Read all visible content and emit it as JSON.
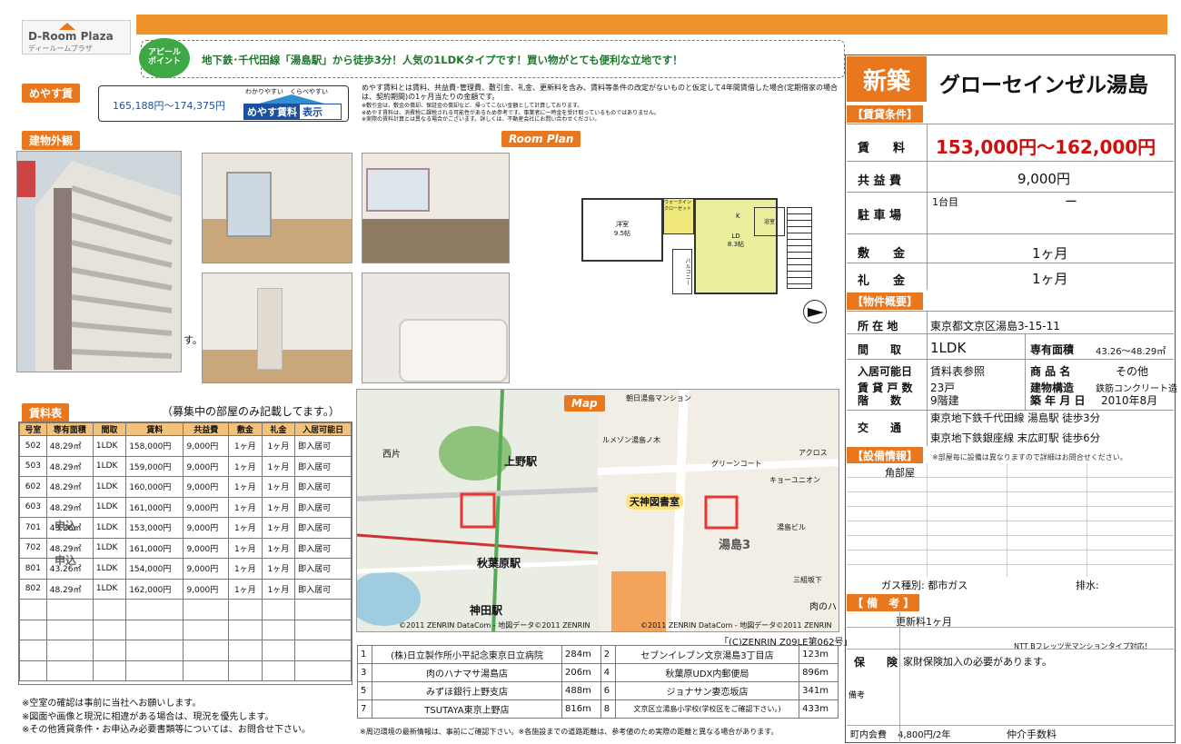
{
  "logo": {
    "line1": "D-Room Plaza",
    "line2": "ディールームプラザ"
  },
  "appeal": {
    "badge": "アピールポイント",
    "text": "地下鉄･千代田線「湯島駅」から徒歩3分！人気の1LDKタイプです！買い物がとても便利な立地です！"
  },
  "meyasu": {
    "tab": "めやす賃",
    "range": "165,188円～174,375円",
    "badge_top": "わかりやすい　くらべやすい",
    "badge": "めやす賃料",
    "badge_suffix": "表示",
    "note_main": "めやす賃料とは賃料、共益費･管理費、敷引金、礼金、更新料を含み、賃料等条件の改定がないものと仮定して4年間賃借した場合(定期借家の場合は、契約期間)の1ヶ月当たりの金額です。",
    "note_sub1": "※敷引金は、敷金の償却、保証金の償却など、帰ってこない金額として計算しております。",
    "note_sub2": "※めやす賃料は、消費税に課税される可能性があるため参考です。事業者に一時金を受け取っているものではありません。",
    "note_sub3": "※実際の賃料計算とは異なる場合がございます。詳しくは、不動産会社にお問い合わせください。"
  },
  "exterior_tab": "建物外観",
  "room_plan_tab": "Room Plan",
  "exterior_suffix": "す。",
  "floorplan": {
    "room1": "洋室",
    "room1_size": "9.5帖",
    "room2": "LD",
    "room2_size": "8.3帖",
    "closet": "ウォークインクローゼット",
    "bath": "浴室",
    "kitchen": "K",
    "balcony": "バルコニー"
  },
  "rent_table": {
    "tab": "賃料表",
    "note": "（募集中の部屋のみ記載してます。）",
    "headers": [
      "号室",
      "専有面積",
      "間取",
      "賃料",
      "共益費",
      "敷金",
      "礼金",
      "入居可能日"
    ],
    "rows": [
      [
        "502",
        "48.29㎡",
        "1LDK",
        "158,000円",
        "9,000円",
        "1ヶ月",
        "1ヶ月",
        "即入居可"
      ],
      [
        "503",
        "48.29㎡",
        "1LDK",
        "159,000円",
        "9,000円",
        "1ヶ月",
        "1ヶ月",
        "即入居可"
      ],
      [
        "602",
        "48.29㎡",
        "1LDK",
        "160,000円",
        "9,000円",
        "1ヶ月",
        "1ヶ月",
        "即入居可"
      ],
      [
        "603",
        "48.29㎡",
        "1LDK",
        "161,000円",
        "9,000円",
        "1ヶ月",
        "1ヶ月",
        "即入居可"
      ],
      [
        "701",
        "43.26㎡",
        "1LDK",
        "153,000円",
        "9,000円",
        "1ヶ月",
        "1ヶ月",
        "即入居可"
      ],
      [
        "702",
        "48.29㎡",
        "1LDK",
        "161,000円",
        "9,000円",
        "1ヶ月",
        "1ヶ月",
        "即入居可"
      ],
      [
        "801",
        "43.26㎡",
        "1LDK",
        "154,000円",
        "9,000円",
        "1ヶ月",
        "1ヶ月",
        "即入居可"
      ],
      [
        "802",
        "48.29㎡",
        "1LDK",
        "162,000円",
        "9,000円",
        "1ヶ月",
        "1ヶ月",
        "即入居可"
      ]
    ],
    "stamp": "申込"
  },
  "footnotes": [
    "※空室の確認は事前に当社へお願いします。",
    "※図面や画像と現況に相違がある場合は、現況を優先します。",
    "※その他賃貸条件・お申込み必要書類等については、お問合せ下さい。"
  ],
  "map": {
    "tab": "Map",
    "labels": {
      "ueno": "上野駅",
      "akihabara": "秋葉原駅",
      "kanda": "神田駅",
      "nishi": "西片",
      "tenjin": "天神図書室",
      "yushima": "湯島3",
      "mansion": "朝日湯島マンション",
      "green": "グリーンコート",
      "sanpei": "三組坂下",
      "nikunoha": "肉のハ",
      "acros": "アクロス",
      "ruman": "ルメゾン湯島ノ木",
      "yushimabldg": "湯島ビル",
      "kyou": "キョーユニオン"
    },
    "copyright1": "©2011 ZENRIN DataCom - 地図データ©2011 ZENRIN",
    "copyright2": "©2011 ZENRIN DataCom - 地図データ©2011 ZENRIN",
    "zenrin": "「(C)ZENRIN  Z09LE第062号」"
  },
  "nearby": {
    "rows": [
      [
        "1",
        "(株)日立製作所小平記念東京日立病院",
        "284m",
        "2",
        "セブンイレブン文京湯島3丁目店",
        "123m"
      ],
      [
        "3",
        "肉のハナマサ湯島店",
        "206m",
        "4",
        "秋葉原UDX内郵便局",
        "896m"
      ],
      [
        "5",
        "みずほ銀行上野支店",
        "488m",
        "6",
        "ジョナサン妻恋坂店",
        "341m"
      ],
      [
        "7",
        "TSUTAYA東京上野店",
        "816m",
        "8",
        "文京区立湯島小学校(学校区をご確認下さい。)",
        "433m"
      ]
    ],
    "note": "※周辺環境の最新情報は、事前にご確認下さい。※各施設までの道路距離は、参考値のため実際の距離と異なる場合があります。"
  },
  "property": {
    "new_label": "新築",
    "name": "グローセインゼル湯島",
    "conditions_tab": "【賃貸条件】",
    "rent_label": "賃　　料",
    "rent_value": "153,000円～162,000円",
    "kyoeki_label": "共 益 費",
    "kyoeki_value": "9,000円",
    "parking_label": "駐 車 場",
    "parking_count": "1台目",
    "parking_value": "ー",
    "shikikin_label": "敷　　金",
    "shikikin_value": "1ヶ月",
    "reikin_label": "礼　　金",
    "reikin_value": "1ヶ月",
    "overview_tab": "【物件概要】",
    "address_label": "所 在 地",
    "address_value": "東京都文京区湯島3-15-11",
    "layout_label": "間　　取",
    "layout_value": "1LDK",
    "area_label": "専有面積",
    "area_value": "43.26～48.29㎡",
    "movein_label": "入居可能日",
    "movein_value": "賃料表参照",
    "category_label": "商 品 名",
    "category_value": "その他",
    "units_label": "賃 貸 戸 数",
    "units_value": "23戸",
    "structure_label": "建物構造",
    "structure_value": "鉄筋コンクリート造",
    "floors_label": "階　　数",
    "floors_value": "9階建",
    "built_label": "築 年 月 日",
    "built_value": "2010年8月",
    "transit_label": "交　　通",
    "transit1": "東京地下鉄千代田線 湯島駅 徒歩3分",
    "transit2": "東京地下鉄銀座線 末広町駅 徒歩6分",
    "equip_tab": "【設備情報】",
    "equip_note": "※部屋毎に設備は異なりますので詳細はお問合せください。",
    "equip_item": "角部屋",
    "gas_label": "ガス種別: 都市ガス",
    "drain_label": "排水:",
    "remarks_tab": "【 備　考 】",
    "renewal": "更新料1ヶ月",
    "ntt": "NTT Bフレッツ光マンションタイプ対応！",
    "insurance_label": "保　　険",
    "insurance_value": "家財保険加入の必要があります。",
    "remarks_label": "備考",
    "chonai_label": "町内会費",
    "chonai_value": "4,800円/2年",
    "agent_label": "仲介手数料"
  },
  "colors": {
    "orange": "#e8771d",
    "red": "#cc1111",
    "green": "#2f9a3a",
    "blue": "#1b4fa0"
  }
}
